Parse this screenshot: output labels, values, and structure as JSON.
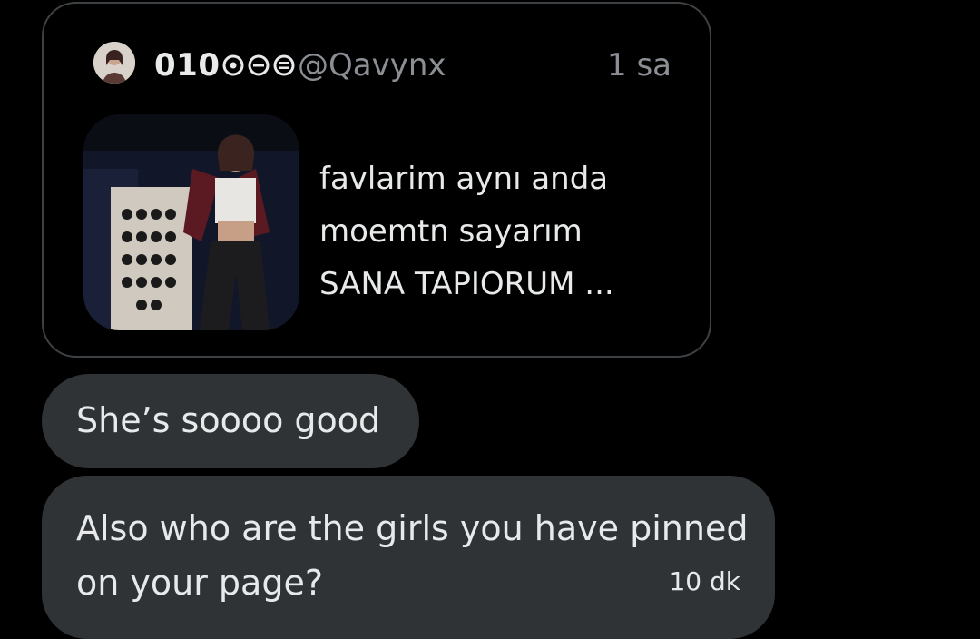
{
  "quoted_tweet": {
    "author_name": "010",
    "name_glyphs": [
      "circle-dot-icon",
      "circle-minus-icon",
      "circle-equals-icon"
    ],
    "handle": "@Qavynx",
    "time": "1 sa",
    "text_lines": [
      "favlarim aynı anda",
      "moemtn sayarım",
      "SANA TAPIORUM ..."
    ]
  },
  "messages": [
    {
      "text": "She’s soooo good"
    },
    {
      "text_lines": [
        "Also who are the girls you have pinned",
        "on your page?"
      ],
      "time": "10 dk"
    }
  ],
  "colors": {
    "background": "#000000",
    "bubble": "#2f3336",
    "border": "#3e4144",
    "muted_text": "#8b8f94",
    "text": "#e7e9ea"
  }
}
